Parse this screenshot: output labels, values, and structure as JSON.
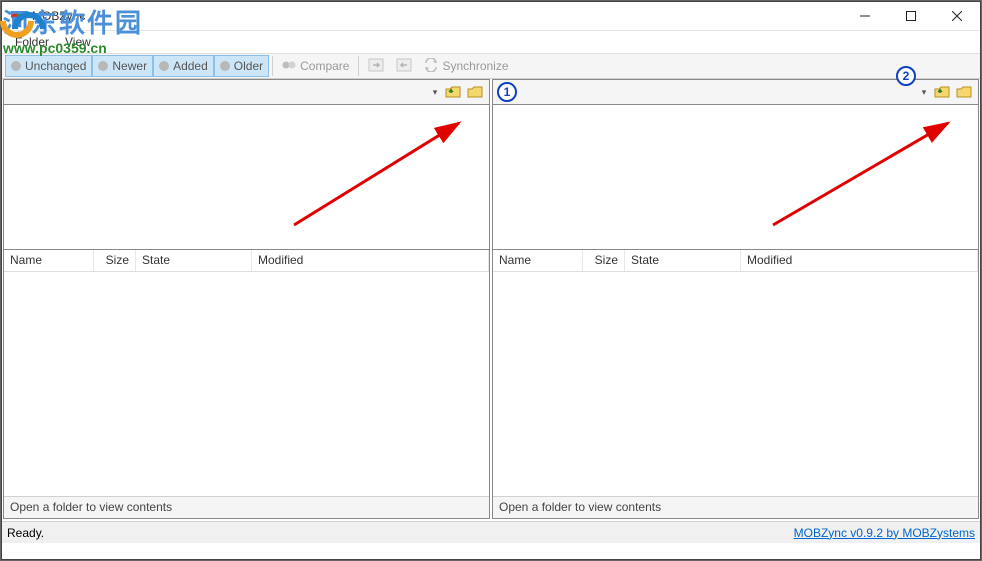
{
  "app": {
    "title": "MOBZync"
  },
  "menu": {
    "folder": "Folder",
    "view": "View"
  },
  "toolbar": {
    "unchanged": "Unchanged",
    "newer": "Newer",
    "added": "Added",
    "older": "Older",
    "compare": "Compare",
    "synchronize": "Synchronize"
  },
  "columns": {
    "name": "Name",
    "size": "Size",
    "state": "State",
    "modified": "Modified"
  },
  "pane_message": "Open a folder to view contents",
  "status": {
    "ready": "Ready.",
    "link": "MOBZync v0.9.2 by MOBZystems"
  },
  "watermark": {
    "text": "河东软件园",
    "url": "www.pc0359.cn"
  },
  "annotations": {
    "badge1": "1",
    "badge2": "2"
  }
}
